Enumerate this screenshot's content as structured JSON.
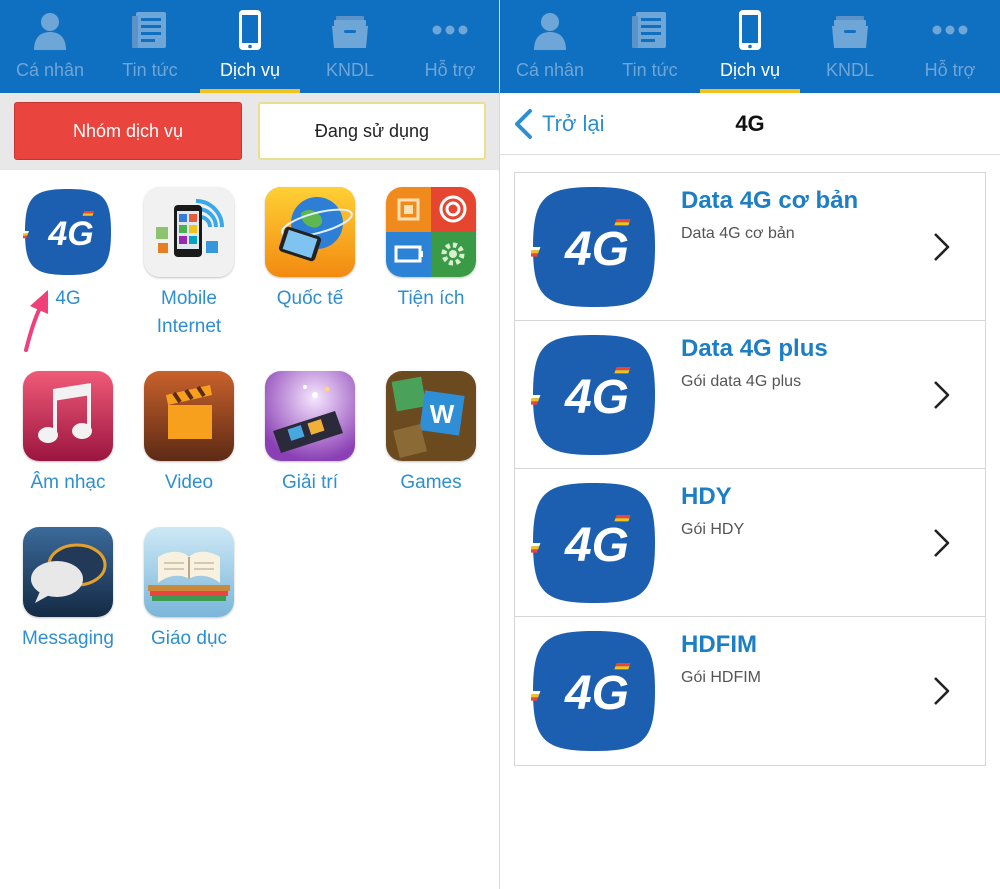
{
  "nav": {
    "items": [
      {
        "label": "Cá nhân",
        "icon": "person-icon"
      },
      {
        "label": "Tin tức",
        "icon": "news-icon"
      },
      {
        "label": "Dịch vụ",
        "icon": "phone-icon"
      },
      {
        "label": "KNDL",
        "icon": "folder-icon"
      },
      {
        "label": "Hỗ trợ",
        "icon": "more-icon"
      }
    ],
    "active_index": 2
  },
  "left": {
    "segment": {
      "primary_label": "Nhóm dịch vụ",
      "secondary_label": "Đang sử dụng"
    },
    "services": [
      {
        "label": "4G",
        "icon": "4g-icon"
      },
      {
        "label": "Mobile\nInternet",
        "icon": "mobile-internet-icon"
      },
      {
        "label": "Quốc tế",
        "icon": "globe-phone-icon"
      },
      {
        "label": "Tiện ích",
        "icon": "utilities-icon"
      },
      {
        "label": "Âm nhạc",
        "icon": "music-note-icon"
      },
      {
        "label": "Video",
        "icon": "clapperboard-icon"
      },
      {
        "label": "Giải trí",
        "icon": "film-strip-icon"
      },
      {
        "label": "Games",
        "icon": "game-blocks-icon"
      },
      {
        "label": "Messaging",
        "icon": "chat-bubbles-icon"
      },
      {
        "label": "Giáo dục",
        "icon": "open-book-icon"
      }
    ]
  },
  "right": {
    "back_label": "Trở lại",
    "title": "4G",
    "packages": [
      {
        "title": "Data 4G cơ bản",
        "subtitle": "Data 4G cơ bản"
      },
      {
        "title": "Data 4G plus",
        "subtitle": "Gói data 4G plus"
      },
      {
        "title": "HDY",
        "subtitle": "Gói HDY"
      },
      {
        "title": "HDFIM",
        "subtitle": "Gói HDFIM"
      }
    ]
  },
  "colors": {
    "nav_bg": "#0f6fc0",
    "nav_active_underline": "#f3c11b",
    "accent_red": "#e9443d",
    "link_blue": "#2d8fd1",
    "annotation_arrow": "#f0407a"
  }
}
